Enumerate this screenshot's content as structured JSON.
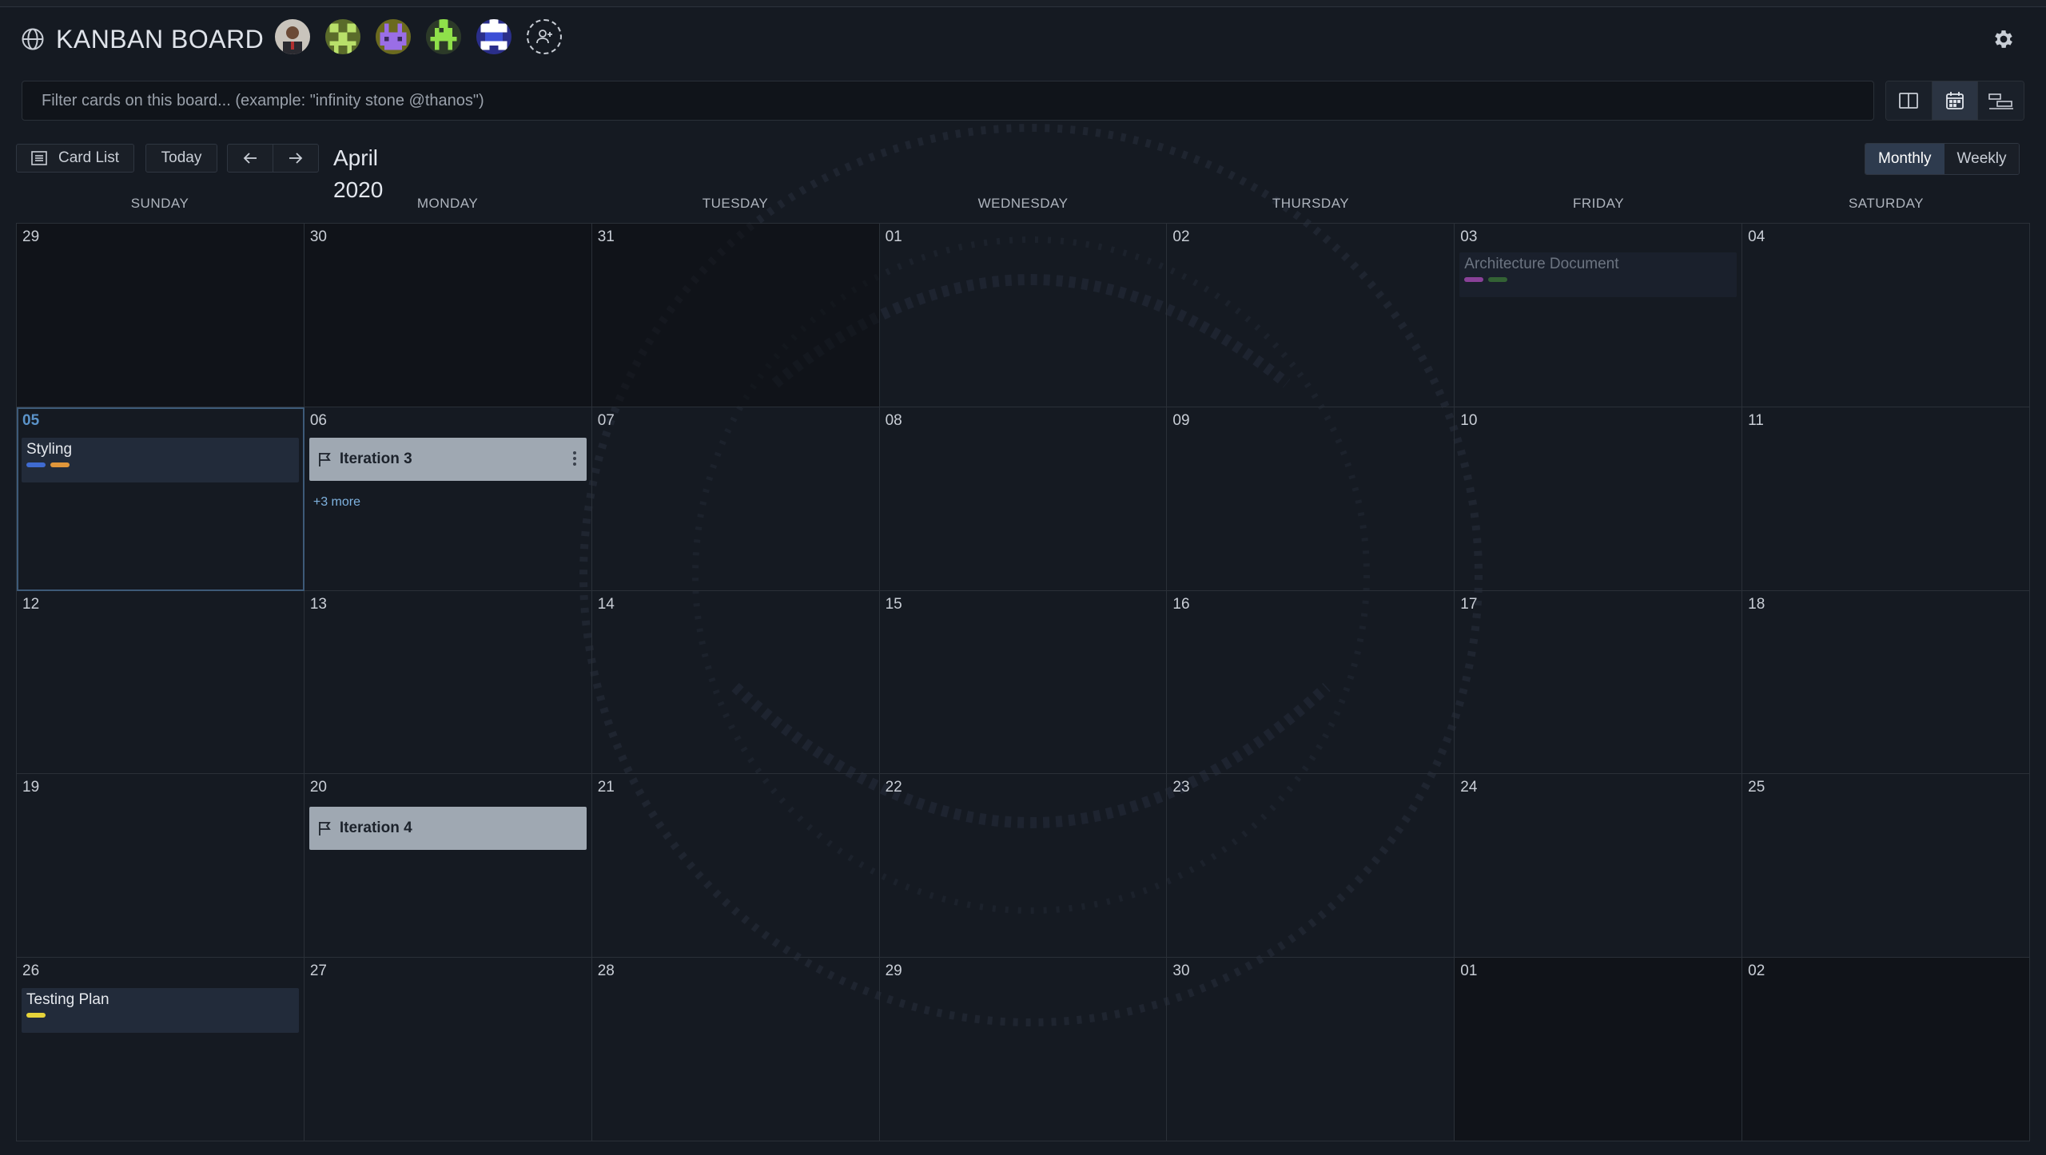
{
  "header": {
    "title": "KANBAN BOARD",
    "avatars": [
      {
        "icon": "user-photo-avatar"
      },
      {
        "icon": "pixel-avatar",
        "color": "#9ccc4a"
      },
      {
        "icon": "pixel-avatar",
        "color": "#8a5cd6"
      },
      {
        "icon": "pixel-avatar",
        "color": "#7fd14a"
      },
      {
        "icon": "pixel-avatar",
        "color": "#3b4ed6"
      }
    ],
    "add_member_icon": "add-member-icon",
    "settings_icon": "gear-icon"
  },
  "filter": {
    "placeholder": "Filter cards on this board... (example: \"infinity stone @thanos\")",
    "value": ""
  },
  "view_switch": [
    "board-view-icon",
    "calendar-view-icon",
    "timeline-view-icon"
  ],
  "toolbar": {
    "card_list_label": "Card List",
    "today_label": "Today",
    "month_label": "April 2020",
    "monthly_label": "Monthly",
    "weekly_label": "Weekly"
  },
  "calendar": {
    "weekdays": [
      "SUNDAY",
      "MONDAY",
      "TUESDAY",
      "WEDNESDAY",
      "THURSDAY",
      "FRIDAY",
      "SATURDAY"
    ],
    "days": [
      "29",
      "30",
      "31",
      "01",
      "02",
      "03",
      "04",
      "05",
      "06",
      "07",
      "08",
      "09",
      "10",
      "11",
      "12",
      "13",
      "14",
      "15",
      "16",
      "17",
      "18",
      "19",
      "20",
      "21",
      "22",
      "23",
      "24",
      "25",
      "26",
      "27",
      "28",
      "29",
      "30",
      "01",
      "02"
    ],
    "cards": {
      "architecture": {
        "title": "Architecture Document",
        "labels": [
          "#b04fc0",
          "#3d7a3a"
        ]
      },
      "styling": {
        "title": "Styling",
        "labels": [
          "#3f6bd1",
          "#e0963a"
        ]
      },
      "iteration3": {
        "title": "Iteration 3",
        "more": "+3 more"
      },
      "iteration4": {
        "title": "Iteration 4"
      },
      "testing": {
        "title": "Testing Plan",
        "labels": [
          "#e6d33a"
        ]
      }
    }
  }
}
